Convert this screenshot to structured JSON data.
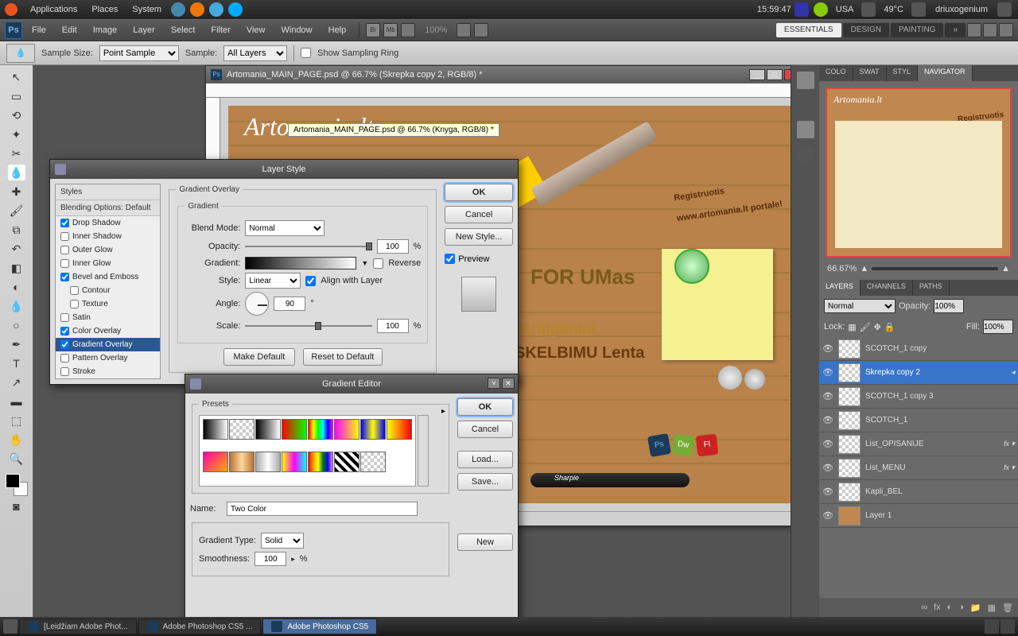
{
  "system": {
    "menus": [
      "Applications",
      "Places",
      "System"
    ],
    "time": "15:59:47",
    "lang": "USA",
    "temp": "49°C",
    "user": "driuxogenium"
  },
  "ps_menu": [
    "File",
    "Edit",
    "Image",
    "Layer",
    "Select",
    "Filter",
    "View",
    "Window",
    "Help"
  ],
  "ps_zoom": "100%",
  "workspaces": {
    "items": [
      "ESSENTIALS",
      "DESIGN",
      "PAINTING"
    ],
    "active": "ESSENTIALS"
  },
  "options": {
    "sample_size_label": "Sample Size:",
    "sample_size_value": "Point Sample",
    "sample_label": "Sample:",
    "sample_value": "All Layers",
    "show_ring": "Show Sampling Ring"
  },
  "document": {
    "title": "Artomania_MAIN_PAGE.psd @ 66.7% (Skrepka copy 2, RGB/8) *",
    "tooltip": "Artomania_MAIN_PAGE.psd @ 66.7% (Knyga, RGB/8) *",
    "art_title": "Artomania.lt",
    "register": "Registruotis",
    "register_sub": "www.artomania.lt portale!",
    "forum": "FOR UMas",
    "straipsniai": "Straipsniai",
    "skelb": "SKELBIMU Lenta"
  },
  "right": {
    "nav_tabs": [
      "COLO",
      "SWAT",
      "STYL",
      "NAVIGATOR"
    ],
    "nav_active": "NAVIGATOR",
    "zoom": "66.67%",
    "layer_tabs": [
      "LAYERS",
      "CHANNELS",
      "PATHS"
    ],
    "layer_active": "LAYERS",
    "blend": "Normal",
    "opacity_label": "Opacity:",
    "opacity": "100%",
    "lock": "Lock:",
    "fill_label": "Fill:",
    "fill": "100%",
    "layers": [
      {
        "name": "SCOTCH_1 copy",
        "fx": false
      },
      {
        "name": "Skrepka copy 2",
        "fx": false,
        "sel": true
      },
      {
        "name": "SCOTCH_1 copy 3",
        "fx": false
      },
      {
        "name": "SCOTCH_1",
        "fx": false
      },
      {
        "name": "List_OPISANIJE",
        "fx": true
      },
      {
        "name": "List_MENU",
        "fx": true
      },
      {
        "name": "Kapli_BEL",
        "fx": false
      },
      {
        "name": "Layer 1",
        "fx": false,
        "wood": true
      }
    ]
  },
  "layer_style": {
    "title": "Layer Style",
    "styles_head": "Styles",
    "blending_head": "Blending Options: Default",
    "items": [
      {
        "label": "Drop Shadow",
        "checked": true
      },
      {
        "label": "Inner Shadow",
        "checked": false
      },
      {
        "label": "Outer Glow",
        "checked": false
      },
      {
        "label": "Inner Glow",
        "checked": false
      },
      {
        "label": "Bevel and Emboss",
        "checked": true
      },
      {
        "label": "Contour",
        "checked": false,
        "indent": true
      },
      {
        "label": "Texture",
        "checked": false,
        "indent": true
      },
      {
        "label": "Satin",
        "checked": false
      },
      {
        "label": "Color Overlay",
        "checked": true
      },
      {
        "label": "Gradient Overlay",
        "checked": true,
        "active": true
      },
      {
        "label": "Pattern Overlay",
        "checked": false
      },
      {
        "label": "Stroke",
        "checked": false
      }
    ],
    "section": "Gradient Overlay",
    "gradient_legend": "Gradient",
    "blend_mode_label": "Blend Mode:",
    "blend_mode": "Normal",
    "opacity_label": "Opacity:",
    "opacity": "100",
    "pct": "%",
    "gradient_label": "Gradient:",
    "reverse": "Reverse",
    "style_label": "Style:",
    "style": "Linear",
    "align": "Align with Layer",
    "angle_label": "Angle:",
    "angle": "90",
    "deg": "°",
    "scale_label": "Scale:",
    "scale": "100",
    "make_default": "Make Default",
    "reset_default": "Reset to Default",
    "ok": "OK",
    "cancel": "Cancel",
    "new_style": "New Style...",
    "preview": "Preview"
  },
  "gradient_editor": {
    "title": "Gradient Editor",
    "presets": "Presets",
    "name_label": "Name:",
    "name": "Two Color",
    "type_label": "Gradient Type:",
    "type": "Solid",
    "smooth_label": "Smoothness:",
    "smooth": "100",
    "pct": "%",
    "ok": "OK",
    "cancel": "Cancel",
    "load": "Load...",
    "save": "Save...",
    "new": "New"
  },
  "gradient_presets": [
    "linear-gradient(90deg,#000,#fff)",
    "repeating-conic-gradient(#ccc 0 25%,#fff 0 50%) 0 0/8px 8px",
    "linear-gradient(90deg,#000,#fff)",
    "linear-gradient(90deg,#f00,#0f0)",
    "linear-gradient(90deg,#f00,#ff0,#0f0,#0ff,#00f,#f0f)",
    "linear-gradient(90deg,#f0f,#ff0)",
    "linear-gradient(90deg,#00f,#ff0,#00f)",
    "linear-gradient(90deg,#ff0,#f00)",
    "linear-gradient(135deg,#f0a,#fa0)",
    "linear-gradient(90deg,#b87333,#ffd79a,#b87333)",
    "linear-gradient(90deg,#aaa,#fff,#aaa)",
    "linear-gradient(90deg,#ff0,#f0f,#0ff)",
    "linear-gradient(90deg,red,orange,yellow,green,blue,violet)",
    "repeating-linear-gradient(45deg,#000 0 4px,#fff 4px 8px)",
    "repeating-conic-gradient(#ccc 0 25%,#fff 0 50%) 0 0/8px 8px"
  ],
  "taskbar": {
    "items": [
      {
        "label": "[Leidžiam Adobe Phot...",
        "active": false
      },
      {
        "label": "Adobe Photoshop CS5 ...",
        "active": false
      },
      {
        "label": "Adobe Photoshop CS5",
        "active": true
      }
    ]
  }
}
